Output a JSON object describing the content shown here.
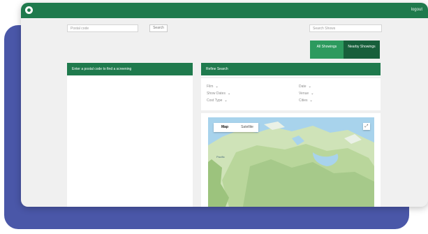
{
  "header": {
    "logout_label": "logout"
  },
  "search": {
    "postal_placeholder": "Postal code",
    "search_button": "Search",
    "filter_placeholder": "Search Shows"
  },
  "toggles": {
    "all_label": "All Showings",
    "nearby_label": "Nearby Showings"
  },
  "left_panel": {
    "title": "Enter a postal code to find a screening"
  },
  "right_panel": {
    "title": "Refine Search"
  },
  "filters": [
    {
      "label": "Film"
    },
    {
      "label": "Date"
    },
    {
      "label": "Show Dates"
    },
    {
      "label": "Venue"
    },
    {
      "label": "Cost Type"
    },
    {
      "label": "Cities"
    }
  ],
  "map": {
    "tab_map": "Map",
    "tab_satellite": "Satellite",
    "fullscreen_icon": "expand-icon",
    "label_ocean": "Pacific"
  },
  "colors": {
    "primary_green": "#1f7a4d",
    "toggle_active": "#175f3b",
    "toggle_inactive": "#2d9a5e",
    "backdrop": "#4a57a8"
  }
}
